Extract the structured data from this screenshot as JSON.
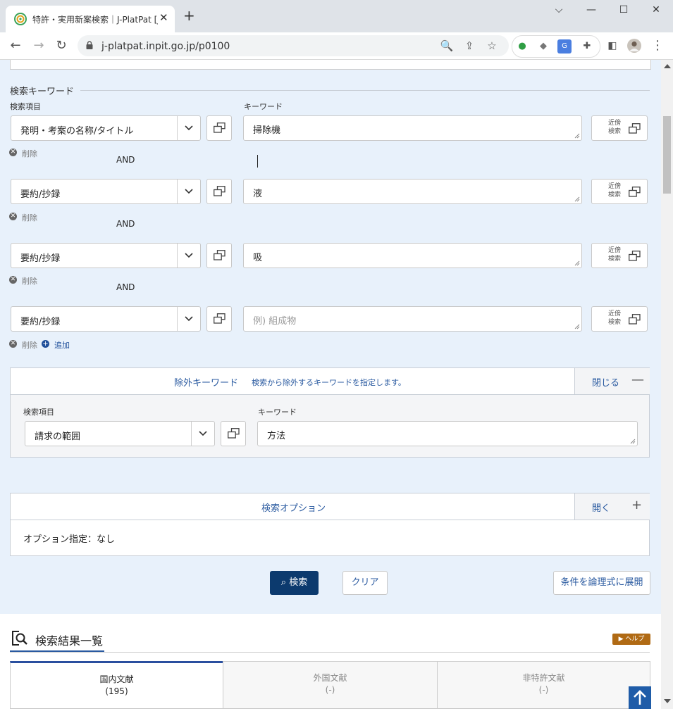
{
  "browser": {
    "tab_title": "特許・実用新案検索｜J-PlatPat [JPO",
    "url": "j-platpat.inpit.go.jp/p0100",
    "window": {
      "minimize": "⌵",
      "restore": "—",
      "maximize": "☐",
      "close": "✕"
    }
  },
  "search_keyword": {
    "section_title": "検索キーワード",
    "field_label": "検索項目",
    "keyword_label": "キーワード",
    "near_search_label": "近傍検索",
    "delete_label": "削除",
    "add_label": "追加",
    "operator": "AND",
    "rows": [
      {
        "field": "発明・考案の名称/タイトル",
        "keyword": "掃除機",
        "placeholder": ""
      },
      {
        "field": "要約/抄録",
        "keyword": "液",
        "placeholder": ""
      },
      {
        "field": "要約/抄録",
        "keyword": "吸",
        "placeholder": ""
      },
      {
        "field": "要約/抄録",
        "keyword": "",
        "placeholder": "例) 組成物"
      }
    ]
  },
  "exclude_keyword": {
    "title": "除外キーワード",
    "description": "検索から除外するキーワードを指定します。",
    "toggle_label": "閉じる",
    "toggle_sign": "—",
    "field_label": "検索項目",
    "keyword_label": "キーワード",
    "field": "請求の範囲",
    "keyword": "方法"
  },
  "search_option": {
    "title": "検索オプション",
    "toggle_label": "開く",
    "toggle_sign": "+",
    "summary": "オプション指定：なし"
  },
  "actions": {
    "search": "検索",
    "clear": "クリア",
    "expand": "条件を論理式に展開"
  },
  "results": {
    "title": "検索結果一覧",
    "help": "▶ ヘルプ",
    "tabs": [
      {
        "label": "国内文献",
        "count": "(195)"
      },
      {
        "label": "外国文献",
        "count": "(-)"
      },
      {
        "label": "非特許文献",
        "count": "(-)"
      }
    ]
  },
  "colors": {
    "page_bg": "#e8f1fb",
    "primary": "#0c3a6e",
    "link": "#2a5aa0",
    "help_badge": "#b06a14"
  }
}
